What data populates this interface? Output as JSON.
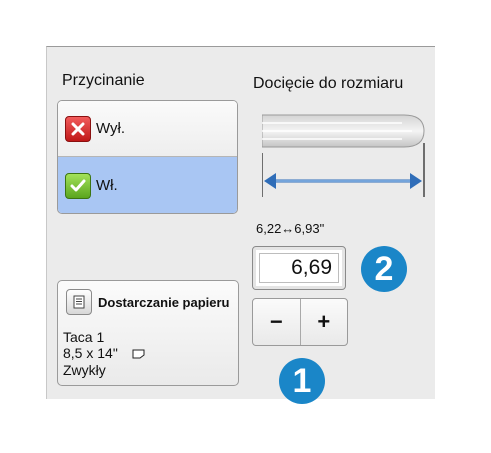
{
  "trimming": {
    "title": "Przycinanie",
    "options": [
      {
        "label": "Wył.",
        "icon": "cross-icon",
        "selected": false
      },
      {
        "label": "Wł.",
        "icon": "check-icon",
        "selected": true
      }
    ]
  },
  "trim_to_size": {
    "title": "Docięcie do rozmiaru",
    "range_label": "6,22↔6,93\"",
    "value": "6,69",
    "decrement_label": "−",
    "increment_label": "+"
  },
  "callouts": {
    "value_box": "2",
    "stepper": "1"
  },
  "paper_supply": {
    "title": "Dostarczanie papieru",
    "tray": "Taca 1",
    "size": "8,5 x 14\"",
    "type": "Zwykły",
    "icon": "paper-tray-icon"
  },
  "colors": {
    "selected_bg": "#a9c6f3",
    "callout": "#1a86c8",
    "panel": "#ebebeb"
  }
}
